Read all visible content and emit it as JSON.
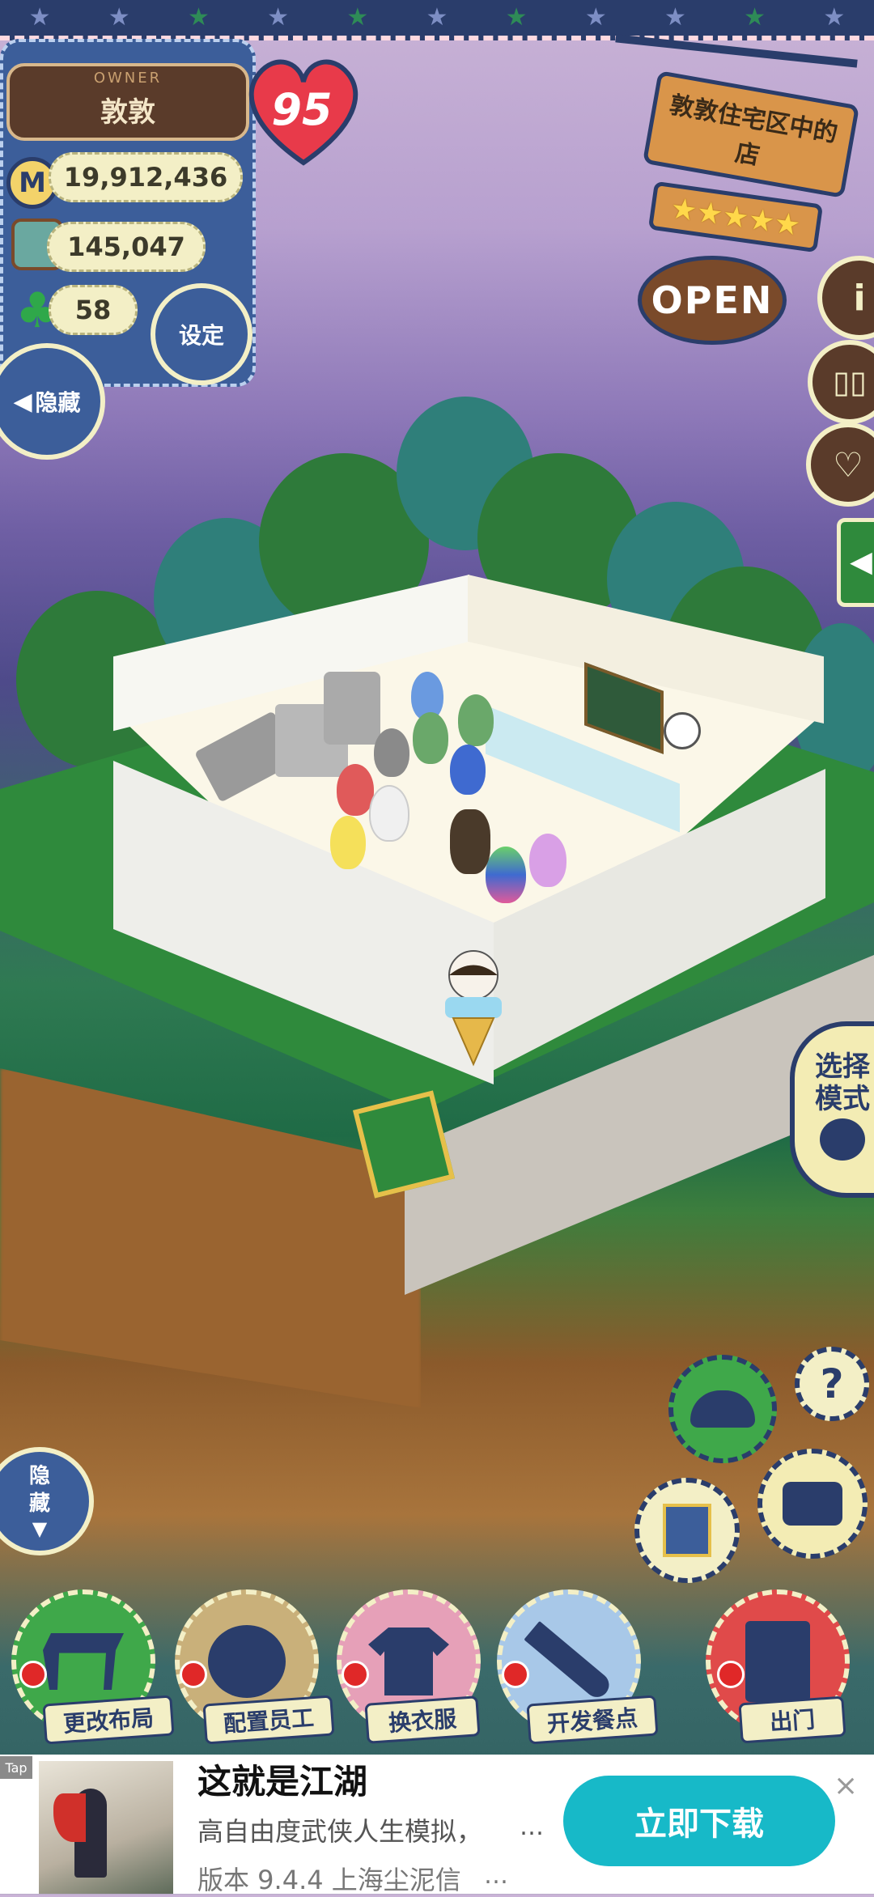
{
  "owner": {
    "tag": "OWNER",
    "name": "敦敦",
    "level": "95"
  },
  "stats": {
    "coins": "19,912,436",
    "ingredients": "145,047",
    "clover": "58"
  },
  "buttons": {
    "settings": "设定",
    "hide_top": "隐藏",
    "hide_bottom": "隐\n藏",
    "select_mode": "选择\n模式"
  },
  "shop_sign": {
    "name": "敦敦住宅区中的店",
    "stars": 5,
    "status": "OPEN"
  },
  "side_icons": [
    "info-icon",
    "book-icon",
    "heart-chat-icon"
  ],
  "actions": [
    {
      "label": "更改布局",
      "icon": "table-icon",
      "color": "#3fa84a"
    },
    {
      "label": "配置员工",
      "icon": "bear-icon",
      "color": "#c9b07a"
    },
    {
      "label": "换衣服",
      "icon": "shirt-icon",
      "color": "#e6a0b8"
    },
    {
      "label": "开发餐点",
      "icon": "knife-icon",
      "color": "#a8c8e8"
    },
    {
      "label": "出门",
      "icon": "door-icon",
      "color": "#e04a4a"
    }
  ],
  "tools": [
    "hat-icon",
    "help-icon",
    "album-icon",
    "camera-icon"
  ],
  "ad": {
    "tag": "Tap",
    "title": "这就是江湖",
    "desc": "高自由度武侠人生模拟，",
    "version": "版本 9.4.4   上海尘泥信",
    "cta": "立即下载",
    "close": "×"
  },
  "colors": {
    "navy": "#2a3d6b",
    "cream": "#f3efc6",
    "wood": "#d9954a",
    "cta": "#17b9c8"
  }
}
